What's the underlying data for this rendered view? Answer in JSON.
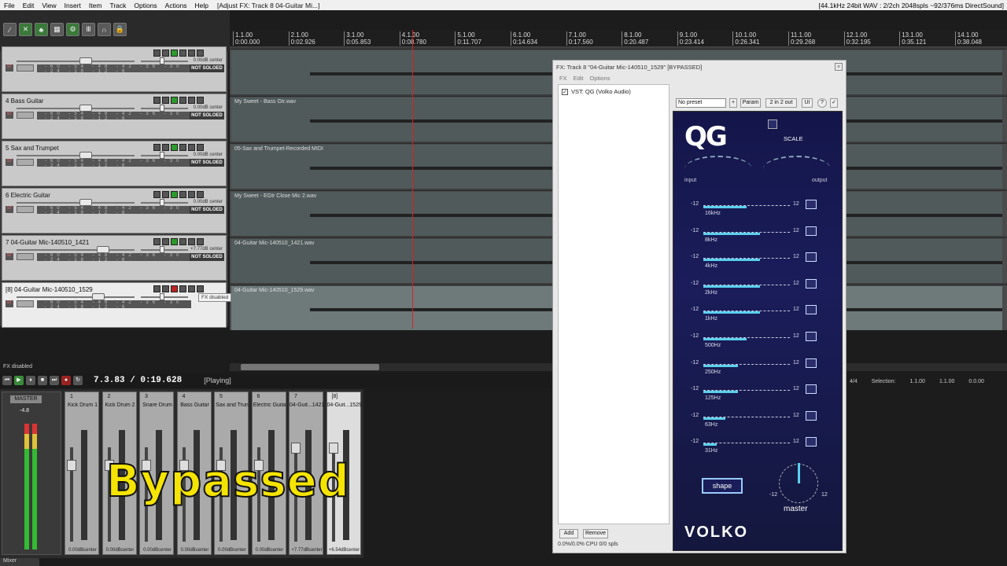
{
  "menubar": {
    "items": [
      "File",
      "Edit",
      "View",
      "Insert",
      "Item",
      "Track",
      "Options",
      "Actions",
      "Help"
    ],
    "title": "[Adjust FX: Track 8 04-Guitar Mi...]",
    "status": "[44.1kHz 24bit WAV : 2/2ch 2048spls ~92/376ms DirectSound]"
  },
  "ruler": {
    "marks": [
      {
        "bar": "1.1.00",
        "time": "0:00.000"
      },
      {
        "bar": "2.1.00",
        "time": "0:02.926"
      },
      {
        "bar": "3.1.00",
        "time": "0:05.853"
      },
      {
        "bar": "4.1.00",
        "time": "0:08.780"
      },
      {
        "bar": "5.1.00",
        "time": "0:11.707"
      },
      {
        "bar": "6.1.00",
        "time": "0:14.634"
      },
      {
        "bar": "7.1.00",
        "time": "0:17.560"
      },
      {
        "bar": "8.1.00",
        "time": "0:20.487"
      },
      {
        "bar": "9.1.00",
        "time": "0:23.414"
      },
      {
        "bar": "10.1.00",
        "time": "0:26.341"
      },
      {
        "bar": "11.1.00",
        "time": "0:29.268"
      },
      {
        "bar": "12.1.00",
        "time": "0:32.195"
      },
      {
        "bar": "13.1.00",
        "time": "0:35.121"
      },
      {
        "bar": "14.1.00",
        "time": "0:38.048"
      }
    ]
  },
  "tracks": [
    {
      "num": "",
      "name": "",
      "db": "0.00dB center",
      "solo": "NOT SOLOED",
      "item": ""
    },
    {
      "num": "4",
      "name": "Bass Guitar",
      "db": "0.00dB center",
      "solo": "NOT SOLOED",
      "item": "My Sweet - Bass Gtr.wav"
    },
    {
      "num": "5",
      "name": "Sax and Trumpet",
      "db": "0.00dB center",
      "solo": "NOT SOLOED",
      "item": "05-Sax and Trumpet-Recorded MIDI"
    },
    {
      "num": "6",
      "name": "Electric Guitar",
      "db": "0.00dB center",
      "solo": "NOT SOLOED",
      "item": "My Sweet - EGtr Close Mic 2.wav"
    },
    {
      "num": "7",
      "name": "04-Guitar Mic-140510_1421",
      "db": "+7.77dB center",
      "solo": "NOT SOLOED",
      "item": "04-Guitar Mic-140510_1421.wav"
    },
    {
      "num": "[8]",
      "name": "04-Guitar Mic-140510_1529",
      "db": "",
      "solo": "",
      "item": "04-Guitar Mic-140510_1529.wav"
    }
  ],
  "meter_scale": "-60 -54 -48 -42 -36 -30 -24 -18 -12 -6",
  "tooltip": "FX disabled",
  "status_fx": "FX disabled",
  "transport": {
    "time": "7.3.83 / 0:19.628",
    "state": "[Playing]"
  },
  "selection": {
    "ratio": "4/4",
    "label": "Selection:",
    "start": "1.1.00",
    "end": "1.1.00",
    "len": "0.0.00"
  },
  "mixer": {
    "master_label": "MASTER",
    "master_db": "-4.8",
    "strips": [
      {
        "num": "1",
        "name": "Kick Drum 1",
        "vol": "0.00dBcenter"
      },
      {
        "num": "2",
        "name": "Kick Drum 2",
        "vol": "0.00dBcenter"
      },
      {
        "num": "3",
        "name": "Snare Drum",
        "vol": "0.00dBcenter"
      },
      {
        "num": "4",
        "name": "Bass Guitar",
        "vol": "0.00dBcenter"
      },
      {
        "num": "5",
        "name": "Sax and Trun",
        "vol": "0.00dBcenter"
      },
      {
        "num": "6",
        "name": "Electric Guita",
        "vol": "0.00dBcenter"
      },
      {
        "num": "7",
        "name": "04-Guit...1421",
        "vol": "+7.77dBcenter"
      },
      {
        "num": "[8]",
        "name": "04-Guit...1529",
        "vol": "+6.54dBcenter"
      }
    ],
    "tab": "Mixer"
  },
  "overlay_text": "Bypassed",
  "fxwindow": {
    "title": "FX: Track 8 \"04-Guitar Mic-140510_1529\" [BYPASSED]",
    "menu": [
      "FX",
      "Edit",
      "Options"
    ],
    "entry": "VST: QG (Volko Audio)",
    "preset": "No preset",
    "buttons": {
      "plus": "+",
      "param": "Param",
      "io": "2 in 2 out",
      "ui": "UI",
      "add": "Add",
      "remove": "Remove"
    },
    "cpu": "0.0%/0.0% CPU 0/0 spls"
  },
  "plugin": {
    "logo": "QG",
    "scale": "SCALE",
    "input": "input",
    "output": "output",
    "bands": [
      {
        "label": "16kHz",
        "lo": "-12",
        "hi": "12",
        "level": 0.5
      },
      {
        "label": "8kHz",
        "lo": "-12",
        "hi": "12",
        "level": 0.65
      },
      {
        "label": "4kHz",
        "lo": "-12",
        "hi": "12",
        "level": 0.65
      },
      {
        "label": "2kHz",
        "lo": "-12",
        "hi": "12",
        "level": 0.65
      },
      {
        "label": "1kHz",
        "lo": "-12",
        "hi": "12",
        "level": 0.65
      },
      {
        "label": "500Hz",
        "lo": "-12",
        "hi": "12",
        "level": 0.5
      },
      {
        "label": "250Hz",
        "lo": "-12",
        "hi": "12",
        "level": 0.4
      },
      {
        "label": "125Hz",
        "lo": "-12",
        "hi": "12",
        "level": 0.4
      },
      {
        "label": "63Hz",
        "lo": "-12",
        "hi": "12",
        "level": 0.25
      },
      {
        "label": "31Hz",
        "lo": "-12",
        "hi": "12",
        "level": 0.15
      }
    ],
    "shape": "shape",
    "knob_lo": "-12",
    "knob_hi": "12",
    "master": "master",
    "brand": "VOLKO"
  }
}
